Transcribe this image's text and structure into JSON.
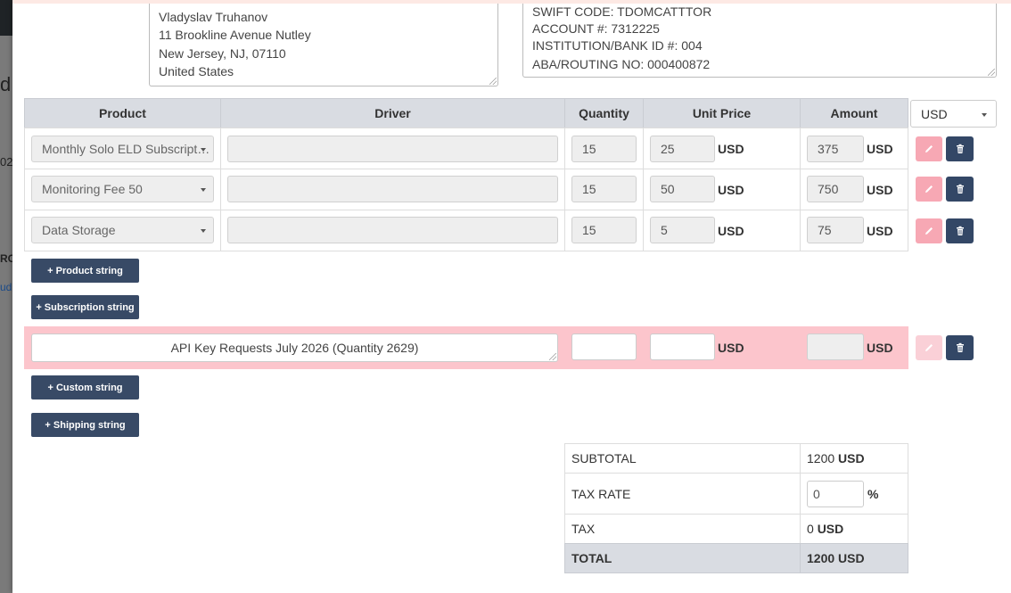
{
  "background": {
    "left_char": "d:",
    "left_num": "02",
    "left_rc": "RC",
    "left_ud": "ud"
  },
  "customer_address": {
    "lines": [
      "Vladyslav Truhanov",
      "11 Brookline Avenue Nutley",
      "New Jersey, NJ, 07110",
      "United States"
    ]
  },
  "bank_details": {
    "lines": [
      "SWIFT CODE: TDOMCATTTOR",
      "ACCOUNT #: 7312225",
      "INSTITUTION/BANK ID #: 004",
      "ABA/ROUTING NO: 000400872"
    ]
  },
  "table": {
    "headers": {
      "product": "Product",
      "driver": "Driver",
      "quantity": "Quantity",
      "unit_price": "Unit Price",
      "amount": "Amount"
    },
    "currency_select": "USD",
    "rows": [
      {
        "product": "Monthly Solo ELD Subscript…",
        "driver": "",
        "quantity": "15",
        "unit_price": "25",
        "unit_currency": "USD",
        "amount": "375",
        "amount_currency": "USD"
      },
      {
        "product": "Monitoring Fee 50",
        "driver": "",
        "quantity": "15",
        "unit_price": "50",
        "unit_currency": "USD",
        "amount": "750",
        "amount_currency": "USD"
      },
      {
        "product": "Data Storage",
        "driver": "",
        "quantity": "15",
        "unit_price": "5",
        "unit_currency": "USD",
        "amount": "75",
        "amount_currency": "USD"
      }
    ]
  },
  "buttons": {
    "product_string": "+ Product string",
    "subscription_string": "+ Subscription string",
    "custom_string": "+ Custom string",
    "shipping_string": "+ Shipping string"
  },
  "custom_row": {
    "description": "API Key Requests July 2026 (Quantity 2629)",
    "quantity": "",
    "unit_price": "",
    "unit_currency": "USD",
    "amount": "",
    "amount_currency": "USD"
  },
  "totals": {
    "subtotal_label": "SUBTOTAL",
    "subtotal_value": "1200",
    "subtotal_currency": "USD",
    "tax_rate_label": "TAX RATE",
    "tax_rate_value": "0",
    "tax_rate_unit": "%",
    "tax_label": "TAX",
    "tax_value": "0",
    "tax_currency": "USD",
    "total_label": "TOTAL",
    "total_value": "1200",
    "total_currency": "USD"
  },
  "icons": {
    "edit": "pencil-icon",
    "delete": "trash-icon",
    "dropdown": "caret-down-icon"
  },
  "colors": {
    "header_bg": "#d9dce2",
    "navy_button": "#384a66",
    "delete_button": "#334766",
    "edit_button": "#f7a8b4",
    "custom_row_bg": "#fcc5cc"
  }
}
